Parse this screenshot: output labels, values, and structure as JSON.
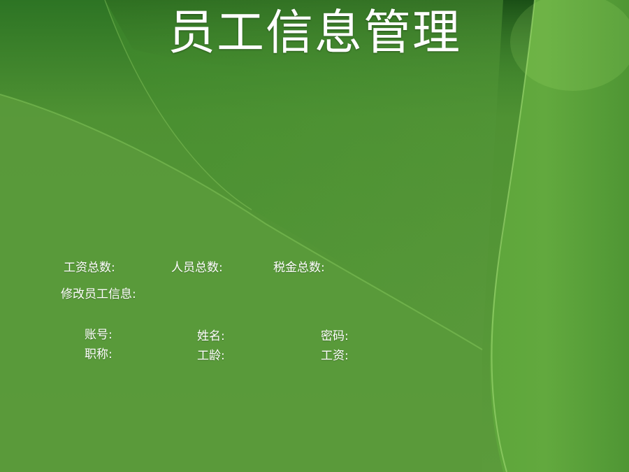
{
  "page": {
    "title": "员工信息管理"
  },
  "summary": {
    "total_salary_label": "工资总数:",
    "total_staff_label": "人员总数:",
    "total_tax_label": "税金总数:"
  },
  "edit_section": {
    "heading": "修改员工信息:",
    "account_label": "账号:",
    "name_label": "姓名:",
    "password_label": "密码:",
    "title_label": "职称:",
    "seniority_label": "工龄:",
    "salary_label": "工资:"
  },
  "colors": {
    "background_main": "#5a9a3a",
    "background_dark": "#1f5e1a",
    "text": "#ffffff"
  }
}
